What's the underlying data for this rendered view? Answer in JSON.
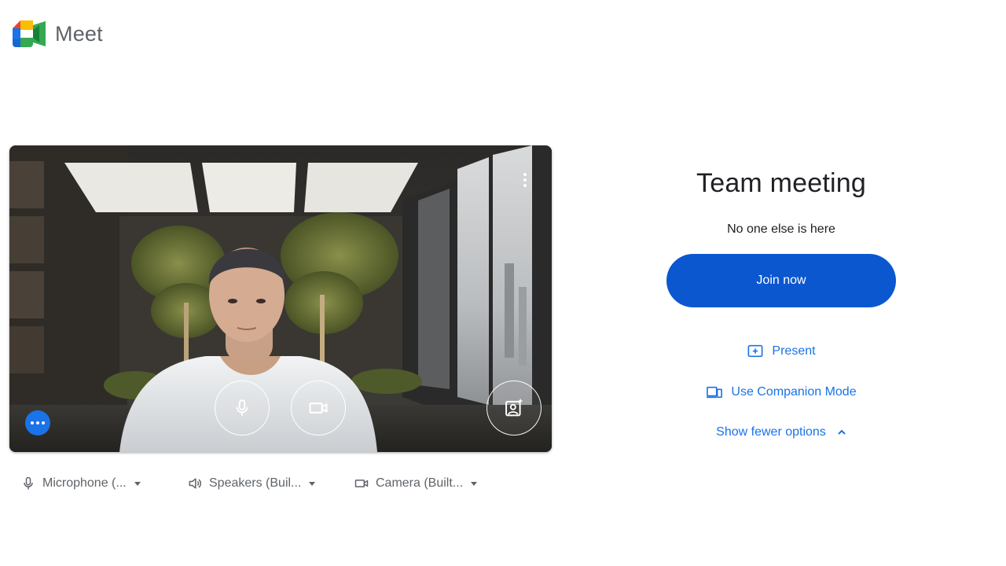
{
  "app": {
    "name": "Meet"
  },
  "meeting": {
    "title": "Team meeting",
    "status": "No one else is here",
    "join_label": "Join now",
    "present_label": "Present",
    "companion_label": "Use Companion Mode",
    "fewer_label": "Show fewer options"
  },
  "devices": {
    "microphone": "Microphone (...",
    "speakers": "Speakers (Buil...",
    "camera": "Camera (Built..."
  },
  "icons": {
    "logo": "google-meet-logo",
    "preview_more": "more-vert-icon",
    "mic": "microphone-icon",
    "camera": "videocam-icon",
    "effects": "visual-effects-icon",
    "more_options": "more-horiz-icon",
    "present": "present-screen-icon",
    "companion": "companion-devices-icon",
    "fewer": "chevron-up-icon",
    "dropdown": "caret-down-icon"
  },
  "colors": {
    "join_button": "#0b57d0",
    "link": "#1a73e8",
    "more_options_button": "#1a73e8"
  }
}
